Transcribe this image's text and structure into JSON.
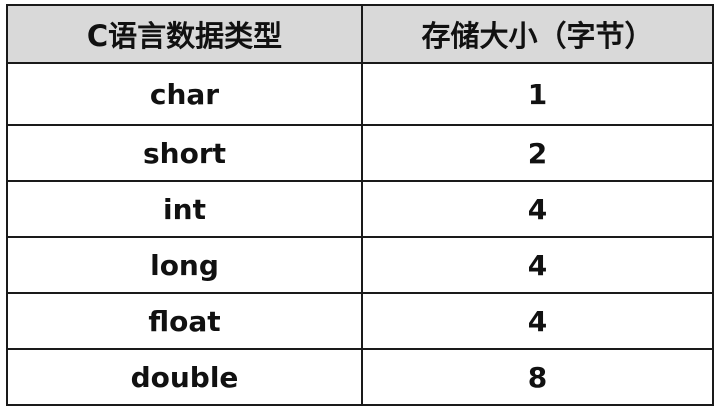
{
  "table": {
    "headers": [
      "C语言数据类型",
      "存储大小（字节）"
    ],
    "rows": [
      [
        "char",
        "1"
      ],
      [
        "short",
        "2"
      ],
      [
        "int",
        "4"
      ],
      [
        "long",
        "4"
      ],
      [
        "float",
        "4"
      ],
      [
        "double",
        "8"
      ]
    ]
  },
  "colors": {
    "header_background": "#d9d9d9",
    "border": "#1a1a1a",
    "text": "#111111"
  }
}
